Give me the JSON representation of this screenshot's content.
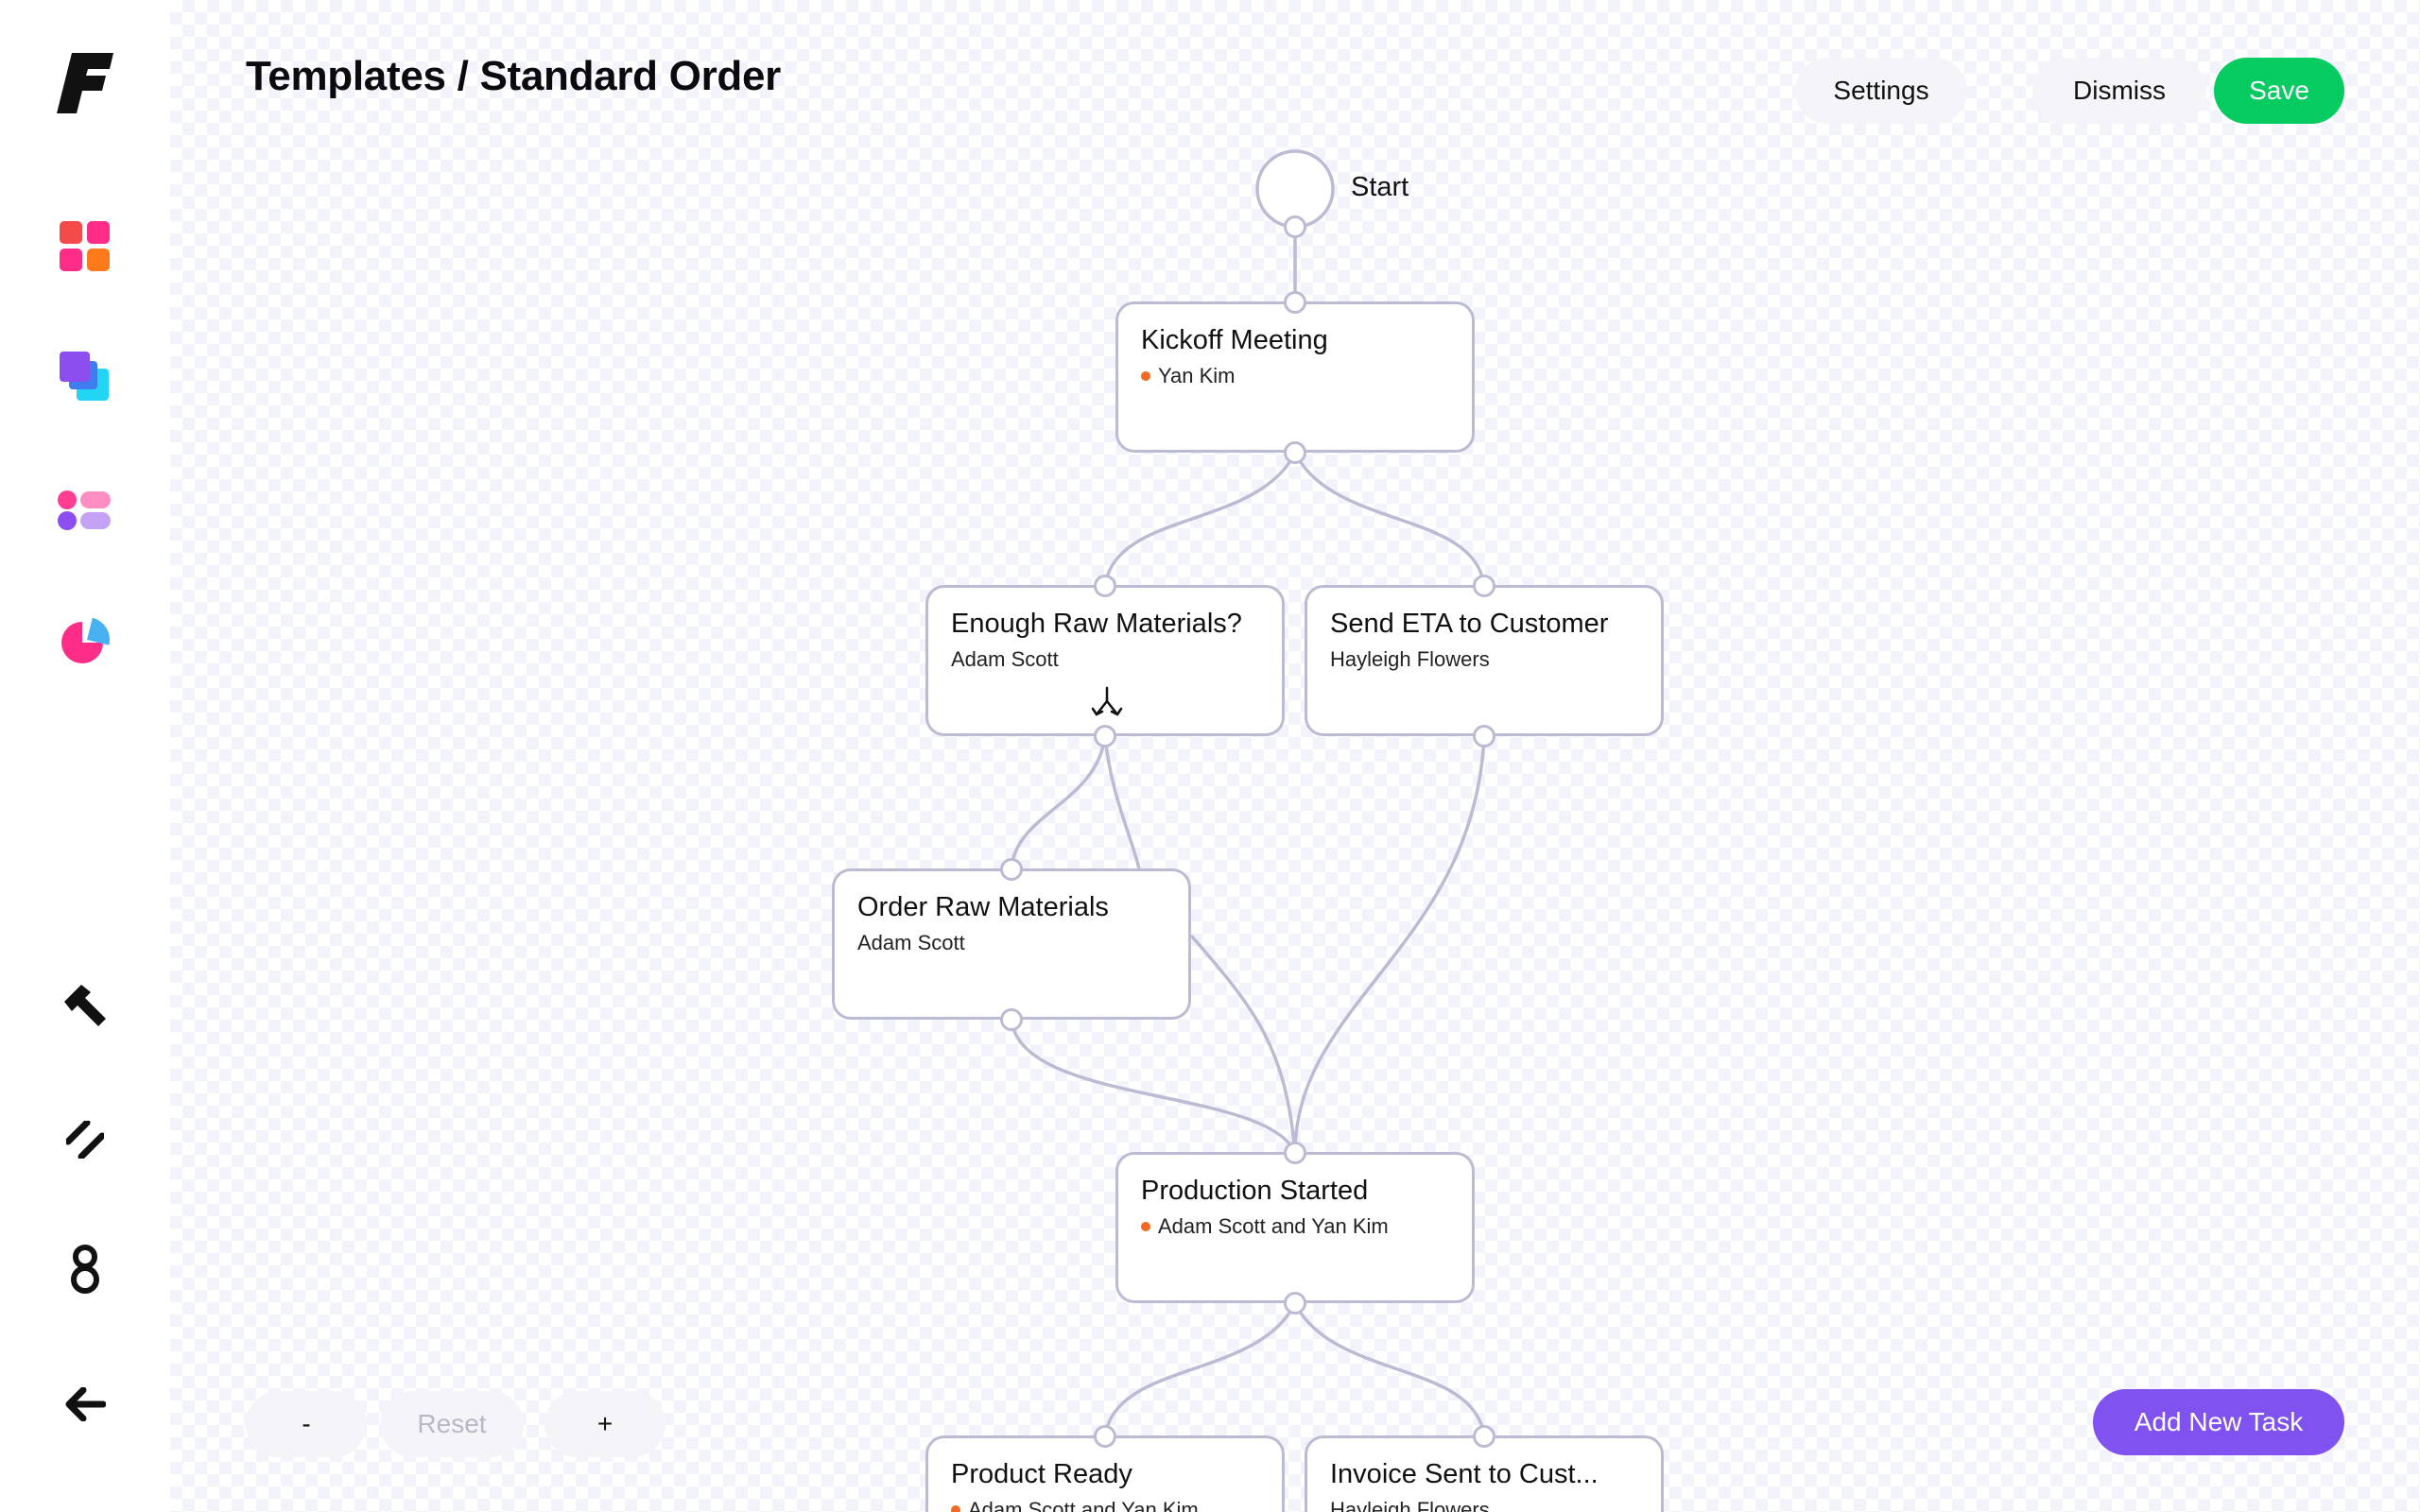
{
  "header": {
    "title": "Templates / Standard Order"
  },
  "toolbar": {
    "settings_label": "Settings",
    "dismiss_label": "Dismiss",
    "save_label": "Save"
  },
  "zoom": {
    "zoom_out_label": "-",
    "reset_label": "Reset",
    "zoom_in_label": "+"
  },
  "add_task_label": "Add New Task",
  "workflow": {
    "start_label": "Start",
    "nodes": [
      {
        "title": "Kickoff Meeting",
        "assignee": "Yan Kim",
        "has_dot": true
      },
      {
        "title": "Enough Raw Materials?",
        "assignee": "Adam Scott",
        "has_dot": false
      },
      {
        "title": "Send ETA to Customer",
        "assignee": "Hayleigh Flowers",
        "has_dot": false
      },
      {
        "title": "Order Raw Materials",
        "assignee": "Adam Scott",
        "has_dot": false
      },
      {
        "title": "Production Started",
        "assignee": "Adam Scott and Yan Kim",
        "has_dot": true
      },
      {
        "title": "Product Ready",
        "assignee": "Adam Scott and Yan Kim",
        "has_dot": true
      },
      {
        "title": "Invoice Sent to Cust...",
        "assignee": "Hayleigh Flowers",
        "has_dot": false
      }
    ]
  },
  "sidebar": {
    "icons": [
      "logo-icon",
      "dashboard-icon",
      "layers-icon",
      "list-icon",
      "pie-chart-icon",
      "hammer-icon",
      "slash-icon",
      "eight-icon",
      "back-arrow-icon"
    ]
  },
  "colors": {
    "save": "#05cb61",
    "primary": "#8052f0",
    "edge": "#bcbbd4",
    "status_dot": "#f26a21"
  }
}
